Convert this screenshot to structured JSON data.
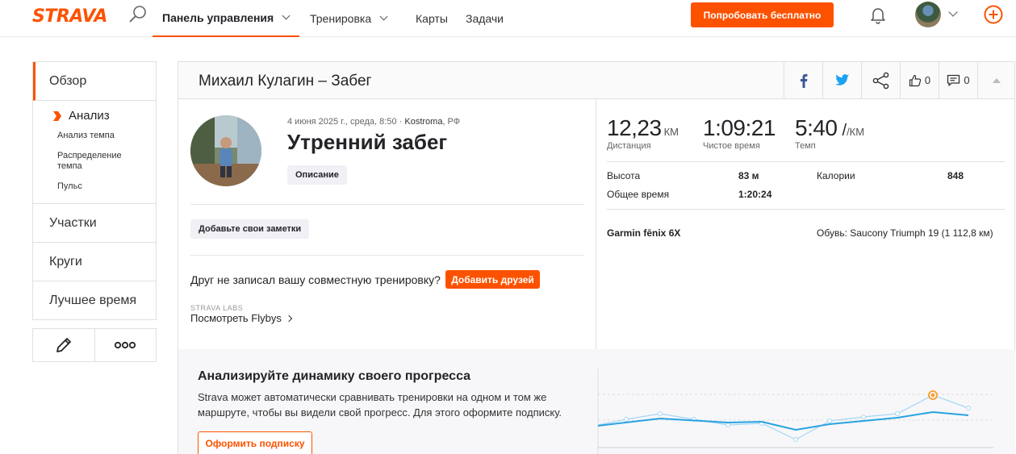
{
  "header": {
    "logo": "STRAVA",
    "nav": [
      {
        "label": "Панель управления",
        "active": true,
        "dropdown": true
      },
      {
        "label": "Тренировка",
        "active": false,
        "dropdown": true
      },
      {
        "label": "Карты",
        "active": false,
        "dropdown": false
      },
      {
        "label": "Задачи",
        "active": false,
        "dropdown": false
      }
    ],
    "trial_button": "Попробовать бесплатно"
  },
  "sidebar": {
    "overview": "Обзор",
    "analysis": "Анализ",
    "sub_items": [
      "Анализ темпа",
      "Распределение темпа",
      "Пульс"
    ],
    "segments": "Участки",
    "laps": "Круги",
    "best_efforts": "Лучшее время"
  },
  "card": {
    "title": "Михаил Кулагин – Забег",
    "kudos_count": "0",
    "comment_count": "0",
    "meta": {
      "date": "4 июня 2025 г., среда, 8:50 · ",
      "location_city": "Kostroma",
      "location_rest": ", РФ"
    },
    "activity_title": "Утренний забег",
    "description_button": "Описание",
    "notes_button": "Добавьте свои заметки",
    "friend_question": "Друг не записал вашу совместную тренировку?",
    "add_friends_button": "Добавить друзей",
    "labs_label": "STRAVA LABS",
    "flyby_prefix": "Посмотреть ",
    "flyby_name": "Flybys",
    "stats": {
      "distance": {
        "value": "12,23",
        "unit": "КМ",
        "label": "Дистанция"
      },
      "moving_time": {
        "value": "1:09:21",
        "label": "Чистое время"
      },
      "pace": {
        "value": "5:40",
        "unit": "/КМ",
        "label": "Темп"
      }
    },
    "details": {
      "elevation_label": "Высота",
      "elevation_value": "83 м",
      "calories_label": "Калории",
      "calories_value": "848",
      "elapsed_label": "Общее время",
      "elapsed_value": "1:20:24"
    },
    "device": "Garmin fēnix 6X",
    "shoes_label": "Обувь: ",
    "shoes_value": "Saucony Triumph 19 (1 112,8 км)"
  },
  "upsell": {
    "title": "Анализируйте динамику своего прогресса",
    "text_brand": "Strava",
    "text_rest": " может автоматически сравнивать тренировки на одном и том же маршруте, чтобы вы видели свой прогресс. Для этого оформите подписку.",
    "button": "Оформить подписку"
  },
  "colors": {
    "accent": "#fc5200",
    "chart_main": "#29a3e0",
    "chart_ghost": "#a6d6f0",
    "highlight": "#f7a33a"
  }
}
